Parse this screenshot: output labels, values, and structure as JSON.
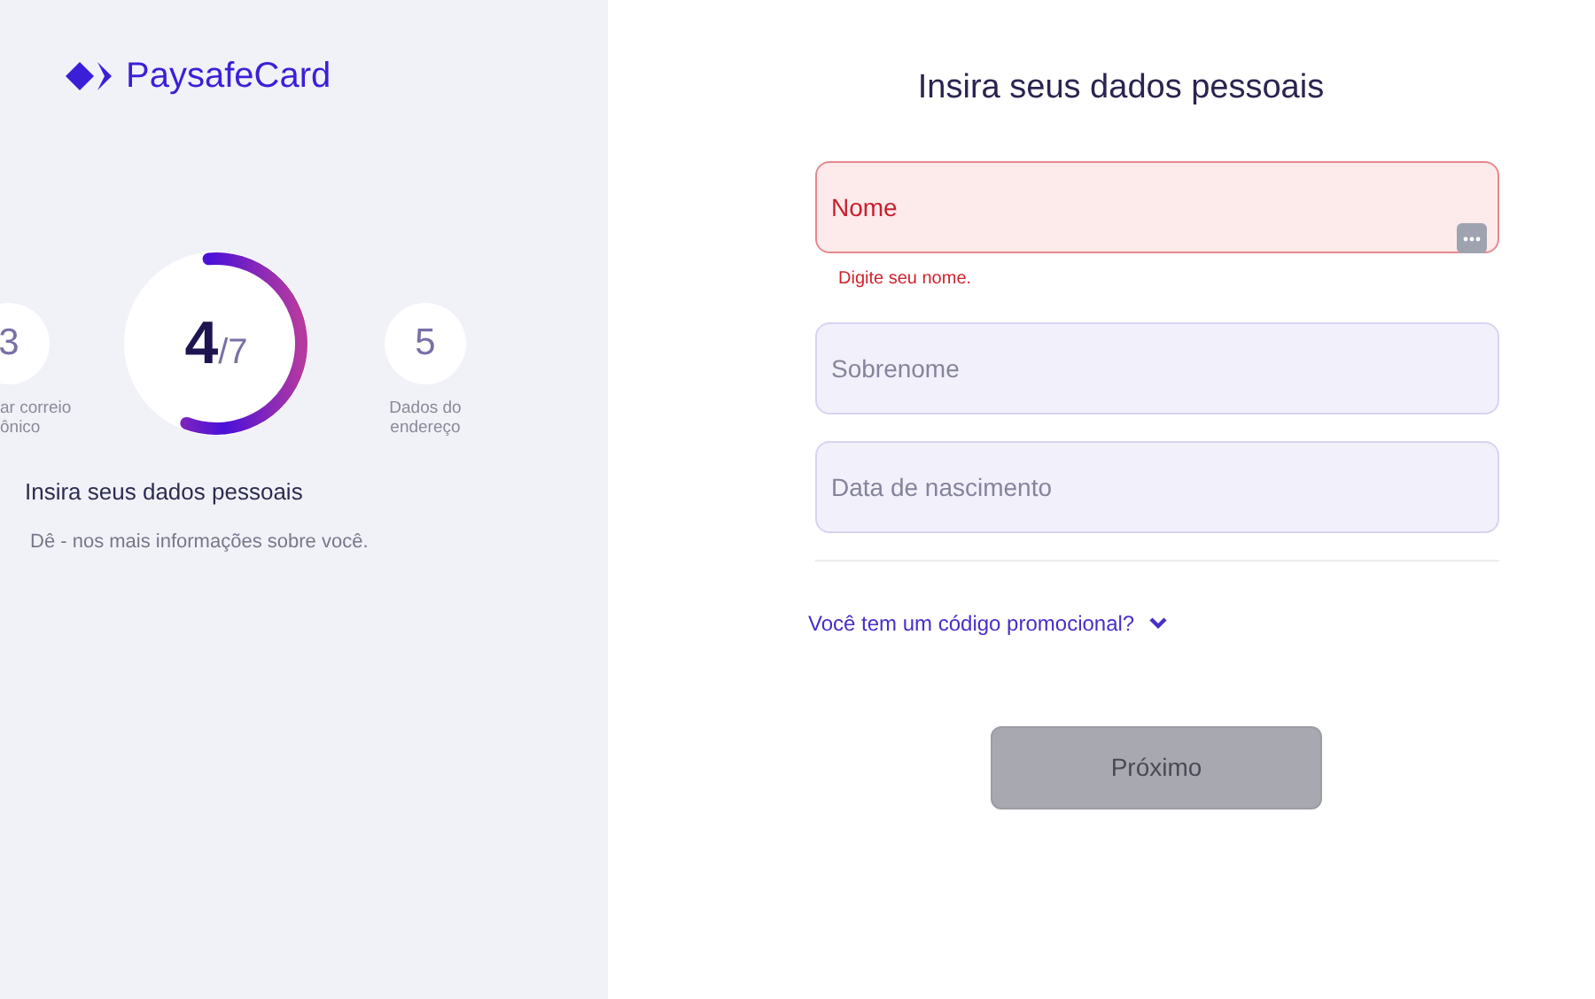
{
  "brand": {
    "name": "PaysafeCard"
  },
  "steps": [
    {
      "kind": "step",
      "number": "3",
      "label_lines": [
        "ar correio",
        "ônico"
      ]
    },
    {
      "kind": "current",
      "number": "4",
      "total": "/7"
    },
    {
      "kind": "step",
      "number": "5",
      "label_lines": [
        "Dados do",
        "endereço"
      ]
    }
  ],
  "step_title": "Insira seus dados pessoais",
  "step_subtitle": "Dê - nos mais informações sobre você.",
  "form": {
    "title": "Insira seus dados pessoais",
    "fields": [
      {
        "placeholder": "Nome",
        "invalid": true,
        "error": "Digite seu nome.",
        "autofill_icon": true
      },
      {
        "placeholder": "Sobrenome",
        "invalid": false
      },
      {
        "placeholder": "Data de nascimento",
        "invalid": false
      }
    ],
    "promo_link": "Você tem um código promocional?",
    "promo_expanded": false,
    "submit": {
      "label": "Próximo",
      "disabled": true
    }
  }
}
